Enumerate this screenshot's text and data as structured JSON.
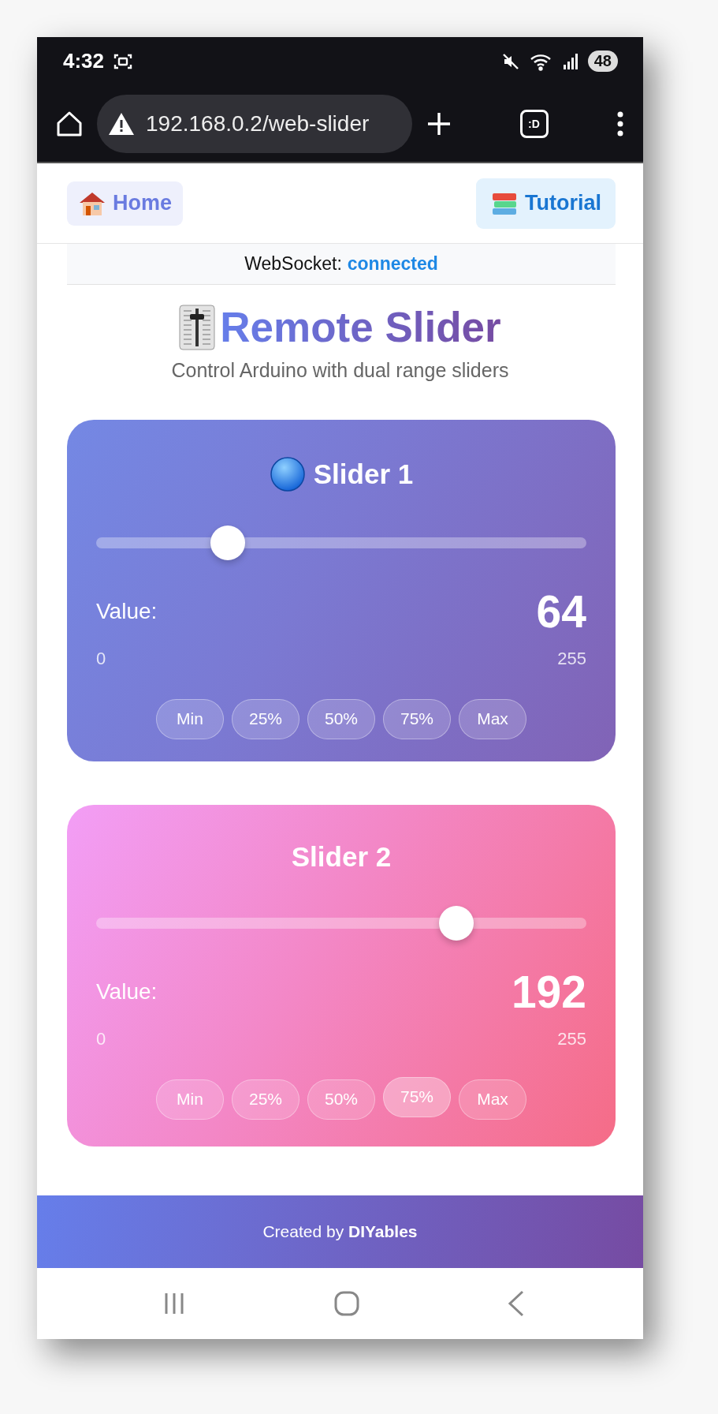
{
  "status_bar": {
    "time": "4:32",
    "battery": "48"
  },
  "browser": {
    "url": "192.168.0.2/web-slider",
    "tab_count": ":D"
  },
  "nav": {
    "home": "Home",
    "tutorial": "Tutorial"
  },
  "connection": {
    "label": "WebSocket:",
    "status": "connected"
  },
  "title": "Remote Slider",
  "subtitle": "Control Arduino with dual range sliders",
  "sliders": [
    {
      "title": "Slider 1",
      "kind": "blue",
      "value_label": "Value:",
      "value": "64",
      "min": "0",
      "max": "255",
      "level": 0.251,
      "presets": [
        {
          "label": "Min",
          "selected": false
        },
        {
          "label": "25%",
          "selected": false
        },
        {
          "label": "50%",
          "selected": false
        },
        {
          "label": "75%",
          "selected": false
        },
        {
          "label": "Max",
          "selected": false
        }
      ]
    },
    {
      "title": "Slider 2",
      "kind": "pink",
      "value_label": "Value:",
      "value": "192",
      "min": "0",
      "max": "255",
      "level": 0.753,
      "presets": [
        {
          "label": "Min",
          "selected": false
        },
        {
          "label": "25%",
          "selected": false
        },
        {
          "label": "50%",
          "selected": false
        },
        {
          "label": "75%",
          "selected": true
        },
        {
          "label": "Max",
          "selected": false
        }
      ]
    }
  ],
  "footer": {
    "prefix": "Created by",
    "brand": "DIYables"
  }
}
